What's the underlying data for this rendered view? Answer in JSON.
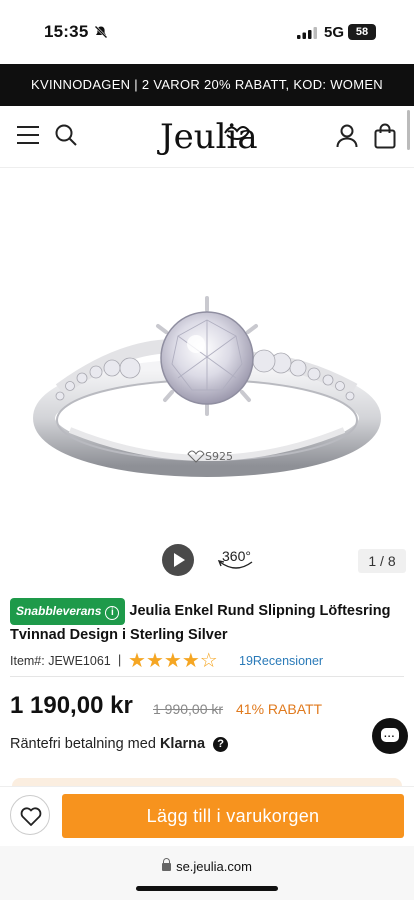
{
  "status_bar": {
    "time": "15:35",
    "network": "5G",
    "battery": "58"
  },
  "promo": {
    "text": "KVINNODAGEN | 2 VAROR 20% RABATT, KOD: WOMEN"
  },
  "header": {
    "logo": "Jeulia"
  },
  "media": {
    "view360_label": "360°",
    "counter": "1 / 8"
  },
  "product": {
    "badge": "Snabbleverans",
    "title": "Jeulia Enkel Rund Slipning Löftesring Tvinnad Design i Sterling Silver",
    "item_no": "Item#: JEWE1061",
    "pipe": "|",
    "rating_stars": 4,
    "reviews": "19Recensioner",
    "price": "1 190,00 kr",
    "old_price": "1 990,00 kr",
    "discount": "41% RABATT",
    "engraving": "S925"
  },
  "klarna": {
    "prefix": "Räntefri betalning med",
    "brand": "Klarna"
  },
  "bottom": {
    "add_to_cart": "Lägg till i varukorgen"
  },
  "url_bar": {
    "url": "se.jeulia.com"
  },
  "colors": {
    "accent": "#f7931e",
    "badge_green": "#1e9a4a",
    "discount": "#e07a1e",
    "star": "#f5a623",
    "link": "#2a7ab8"
  }
}
